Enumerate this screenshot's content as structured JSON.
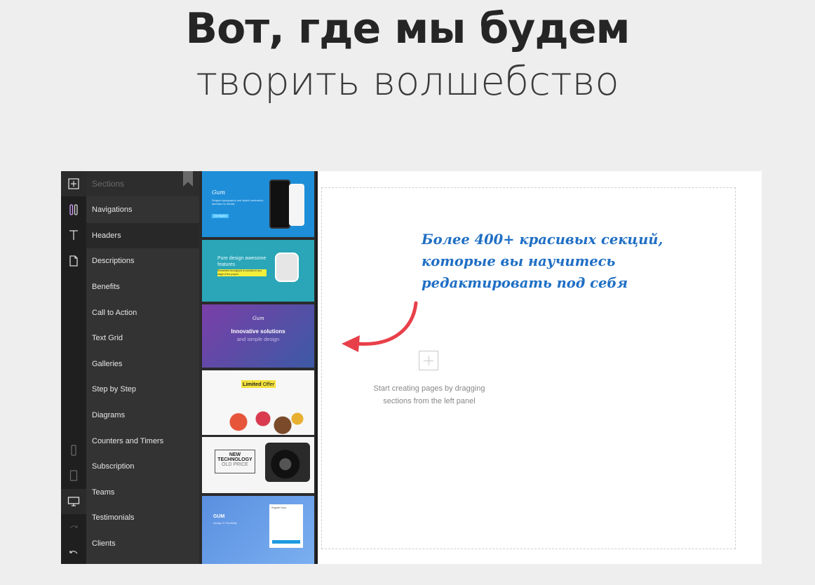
{
  "hero": {
    "title": "Вот, где мы будем",
    "subtitle": "творить волшебство"
  },
  "rail": {
    "items": [
      {
        "icon": "add-square-icon"
      },
      {
        "icon": "palette-icon"
      },
      {
        "icon": "text-icon"
      },
      {
        "icon": "page-icon"
      },
      {
        "icon": "mobile-icon"
      },
      {
        "icon": "tablet-icon"
      },
      {
        "icon": "desktop-icon"
      },
      {
        "icon": "redo-icon"
      },
      {
        "icon": "undo-icon"
      }
    ]
  },
  "sections": {
    "header": "Sections",
    "items": [
      {
        "label": "Navigations"
      },
      {
        "label": "Headers"
      },
      {
        "label": "Descriptions"
      },
      {
        "label": "Benefits"
      },
      {
        "label": "Call to Action"
      },
      {
        "label": "Text Grid"
      },
      {
        "label": "Galleries"
      },
      {
        "label": "Step by Step"
      },
      {
        "label": "Diagrams"
      },
      {
        "label": "Counters and Timers"
      },
      {
        "label": "Subscription"
      },
      {
        "label": "Teams"
      },
      {
        "label": "Testimonials"
      },
      {
        "label": "Clients"
      }
    ],
    "active": "Headers"
  },
  "thumbnails": [
    {
      "brand": "Gum",
      "text": "Elegant typography and stylish animation, attention to details",
      "button": "Get Started"
    },
    {
      "title": "Pure design awesome features",
      "highlight": "Remember throughput is constant in any stage of the project"
    },
    {
      "brand": "Gum",
      "title": "Innovative solutions",
      "subtitle": "and simple design"
    },
    {
      "title_a": "Limited",
      "title_b": "Offer"
    },
    {
      "line1": "NEW",
      "line2": "TECHNOLOGY",
      "line3": "OLD PRICE"
    },
    {
      "title": "GUM",
      "subtitle": "Design & Flexibility",
      "form_title": "Register Now"
    }
  ],
  "canvas": {
    "note": [
      "Более 400+ красивых секций,",
      "которые вы научитесь",
      "редактировать под себя"
    ],
    "start_text": "Start creating pages by dragging sections from the left panel"
  },
  "colors": {
    "accent_blue": "#1f6fc4",
    "arrow_red": "#e8404a",
    "panel_dark": "#333333"
  }
}
